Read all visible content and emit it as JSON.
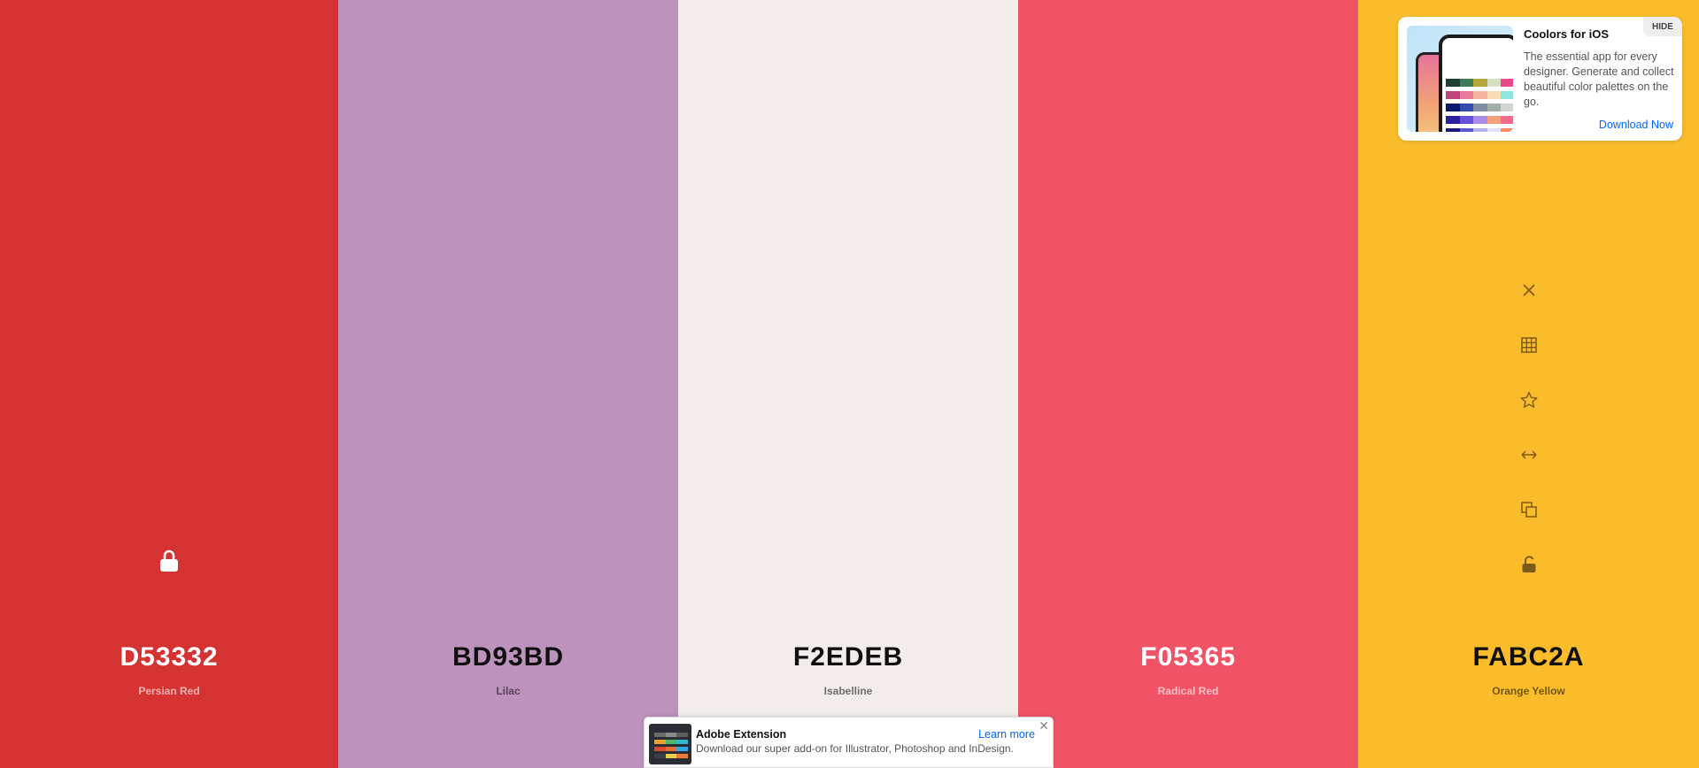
{
  "swatches": [
    {
      "hex": "D53332",
      "name": "Persian Red",
      "color": "#D53332",
      "tone": "light"
    },
    {
      "hex": "BD93BD",
      "name": "Lilac",
      "color": "#BD93BD",
      "tone": "dark"
    },
    {
      "hex": "F2EDEB",
      "name": "Isabelline",
      "color": "#F2EDEB",
      "tone": "dark"
    },
    {
      "hex": "F05365",
      "name": "Radical Red",
      "color": "#F05365",
      "tone": "light"
    },
    {
      "hex": "FABC2A",
      "name": "Orange Yellow",
      "color": "#FABC2A",
      "tone": "dark"
    }
  ],
  "swatch_tools": [
    "close-icon",
    "grid-icon",
    "star-icon",
    "arrows-horizontal-icon",
    "copy-icon",
    "unlock-icon"
  ],
  "ios_ad": {
    "title": "Coolors for iOS",
    "description": "The essential app for every designer. Generate and collect beautiful color palettes on the go.",
    "link": "Download Now",
    "hide": "HIDE"
  },
  "adobe_ad": {
    "title": "Adobe Extension",
    "description": "Download our super add-on for Illustrator, Photoshop and InDesign.",
    "link": "Learn more",
    "close": "✕"
  },
  "colors": {
    "link": "#0066ff",
    "tool_icon": "#7a5a1a"
  }
}
